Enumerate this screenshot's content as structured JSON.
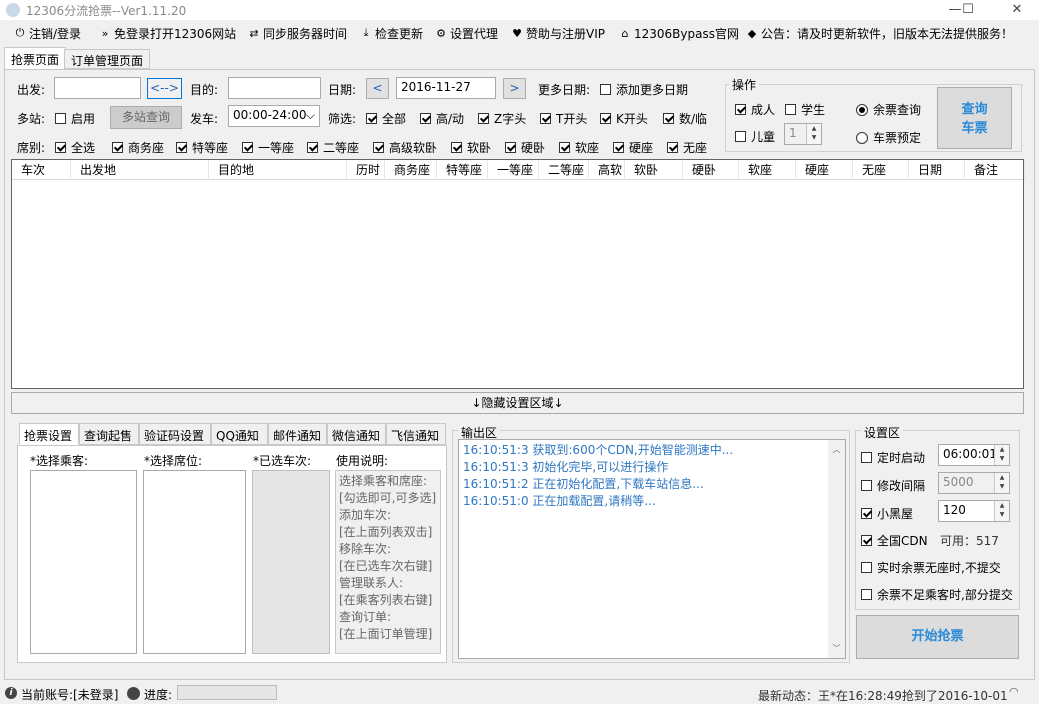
{
  "window": {
    "title": "12306分流抢票--Ver1.11.20",
    "min": "—",
    "max": "☐",
    "close": "✕"
  },
  "menu": [
    {
      "icon": "power-icon",
      "glyph": "⏻",
      "label": "注销/登录"
    },
    {
      "icon": "double-chevron-icon",
      "glyph": "»",
      "label": "免登录打开12306网站"
    },
    {
      "icon": "sync-icon",
      "glyph": "⇄",
      "label": "同步服务器时间"
    },
    {
      "icon": "download-icon",
      "glyph": "⤓",
      "label": "检查更新"
    },
    {
      "icon": "gear-icon",
      "glyph": "⚙",
      "label": "设置代理"
    },
    {
      "icon": "heart-icon",
      "glyph": "♥",
      "label": "赞助与注册VIP"
    },
    {
      "icon": "home-icon",
      "glyph": "⌂",
      "label": "12306Bypass官网"
    },
    {
      "icon": "tag-icon",
      "glyph": "◆",
      "label": "公告：请及时更新软件，旧版本无法提供服务！"
    }
  ],
  "tabs": [
    "抢票页面",
    "订单管理页面"
  ],
  "search": {
    "from_label": "出发:",
    "from_value": "",
    "swap": "<-->",
    "to_label": "目的:",
    "to_value": "",
    "date_label": "日期:",
    "prev": "<",
    "date_value": "2016-11-27",
    "next": ">",
    "more_dates_label": "更多日期:",
    "add_more_dates": "添加更多日期",
    "multi_label": "多站:",
    "enable": "启用",
    "multi_query": "多站查询",
    "depart_label": "发车:",
    "depart_value": "00:00-24:00",
    "filter_label": "筛选:",
    "filters": [
      "全部",
      "高/动",
      "Z字头",
      "T开头",
      "K开头",
      "数/临"
    ],
    "seat_label": "席别:",
    "seats": [
      "全选",
      "商务座",
      "特等座",
      "一等座",
      "二等座",
      "高级软卧",
      "软卧",
      "硬卧",
      "软座",
      "硬座",
      "无座"
    ]
  },
  "operation": {
    "title": "操作",
    "adult": "成人",
    "student": "学生",
    "child": "儿童",
    "child_count": "1",
    "remaining_query": "余票查询",
    "reserve": "车票预定",
    "query_button": "查询\n车票"
  },
  "grid_columns": [
    "车次",
    "出发地",
    "目的地",
    "历时",
    "商务座",
    "特等座",
    "一等座",
    "二等座",
    "高软",
    "软卧",
    "硬卧",
    "软座",
    "硬座",
    "无座",
    "日期",
    "备注"
  ],
  "hide_settings": "↓隐藏设置区域↓",
  "settings_tabs": [
    "抢票设置",
    "查询起售",
    "验证码设置",
    "QQ通知",
    "邮件通知",
    "微信通知",
    "飞信通知"
  ],
  "settings": {
    "passengers": "*选择乘客:",
    "seats": "*选择席位:",
    "trains": "*已选车次:",
    "usage_title": "使用说明:",
    "usage": [
      "选择乘客和席座:",
      "[勾选即可,可多选]",
      "添加车次:",
      "[在上面列表双击]",
      "移除车次:",
      "[在已选车次右键]",
      "管理联系人:",
      "[在乘客列表右键]",
      "查询订单:",
      "[在上面订单管理]"
    ]
  },
  "output": {
    "title": "输出区",
    "lines": [
      "16:10:51:3   获取到:600个CDN,开始智能测速中...",
      "16:10:51:3   初始化完毕,可以进行操作",
      "16:10:51:2   正在初始化配置,下载车站信息...",
      "16:10:51:0   正在加载配置,请稍等..."
    ]
  },
  "settings_area": {
    "title": "设置区",
    "timed_start": "定时启动",
    "timed_value": "06:00:01",
    "modify_interval": "修改间隔",
    "interval_value": "5000",
    "blackroom": "小黑屋",
    "blackroom_value": "120",
    "cdn": "全国CDN",
    "available": "可用：517",
    "no_submit": "实时余票无座时,不提交",
    "partial_submit": "余票不足乘客时,部分提交",
    "start_button": "开始抢票"
  },
  "status": {
    "account": "当前账号:[未登录]",
    "progress": "进度:",
    "news": "最新动态：王*在16:28:49抢到了2016-10-01"
  }
}
